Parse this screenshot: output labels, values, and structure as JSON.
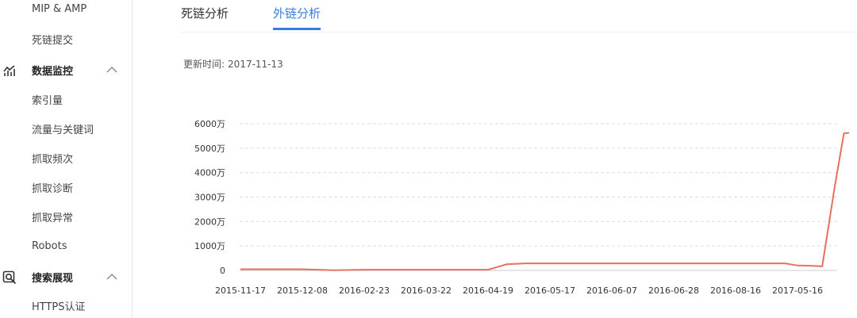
{
  "sidebar": {
    "items": [
      {
        "label": "MIP & AMP",
        "type": "sub"
      },
      {
        "label": "死链提交",
        "type": "sub"
      },
      {
        "label": "数据监控",
        "type": "group",
        "icon": "line-chart-icon",
        "expanded": true
      },
      {
        "label": "索引量",
        "type": "sub"
      },
      {
        "label": "流量与关键词",
        "type": "sub"
      },
      {
        "label": "抓取频次",
        "type": "sub"
      },
      {
        "label": "抓取诊断",
        "type": "sub"
      },
      {
        "label": "抓取异常",
        "type": "sub"
      },
      {
        "label": "Robots",
        "type": "sub"
      },
      {
        "label": "搜索展现",
        "type": "group",
        "icon": "search-magnifier-icon",
        "expanded": true
      },
      {
        "label": "HTTPS认证",
        "type": "sub"
      }
    ]
  },
  "tabs": [
    {
      "label": "死链分析",
      "active": false
    },
    {
      "label": "外链分析",
      "active": true
    }
  ],
  "update": {
    "label": "更新时间:",
    "value": "2017-11-13"
  },
  "colors": {
    "accent": "#3a7de0",
    "series": "#e8705f",
    "grid": "#dddddd"
  },
  "chart_data": {
    "type": "line",
    "ylim": [
      0,
      6000
    ],
    "yticks": [
      0,
      1000,
      2000,
      3000,
      4000,
      5000,
      6000
    ],
    "ytick_labels": [
      "0",
      "1000万",
      "2000万",
      "3000万",
      "4000万",
      "5000万",
      "6000万"
    ],
    "xticks": [
      "2015-11-17",
      "2015-12-08",
      "2016-02-23",
      "2016-03-22",
      "2016-04-19",
      "2016-05-17",
      "2016-06-07",
      "2016-06-28",
      "2016-08-16",
      "2017-05-16"
    ],
    "series": [
      {
        "x": [
          0,
          1,
          1.5,
          2,
          3,
          4,
          4.3,
          4.6,
          5,
          6,
          7,
          8,
          8.8,
          9,
          9.2,
          9.4,
          9.6,
          9.75,
          9.95,
          10.7
        ],
        "values": [
          50,
          50,
          5,
          30,
          30,
          30,
          250,
          290,
          290,
          290,
          290,
          290,
          290,
          200,
          190,
          170,
          3400,
          5600,
          5660,
          5700
        ]
      }
    ]
  }
}
